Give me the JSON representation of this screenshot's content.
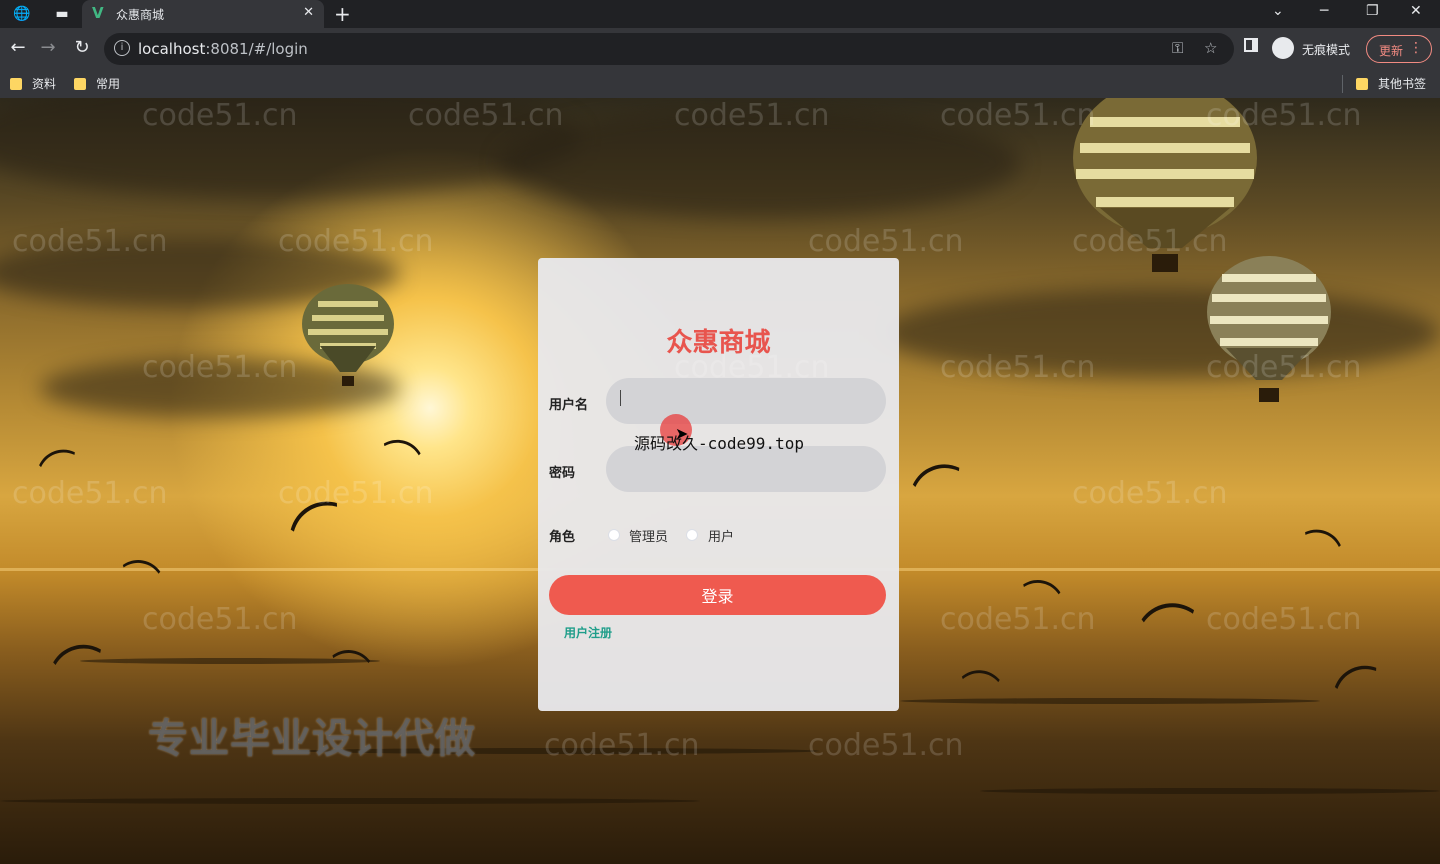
{
  "browser": {
    "tab_title": "众惠商城",
    "tab_favicon": "V",
    "url_host": "localhost",
    "url_rest": ":8081/#/login",
    "incognito_label": "无痕模式",
    "update_label": "更新",
    "bookmarks": [
      "资料",
      "常用"
    ],
    "other_bookmarks": "其他书签"
  },
  "page": {
    "watermark": "code51.cn",
    "promo_text": "专业毕业设计代做",
    "overlay_text": "源码改久-code99.top"
  },
  "login": {
    "title": "众惠商城",
    "username_label": "用户名",
    "password_label": "密码",
    "role_label": "角色",
    "roles": [
      "管理员",
      "用户"
    ],
    "submit_label": "登录",
    "register_link": "用户注册",
    "username_value": "",
    "password_value": ""
  },
  "colors": {
    "title": "#e8554e",
    "button": "#ef5a4f",
    "link": "#1f9e8a"
  }
}
